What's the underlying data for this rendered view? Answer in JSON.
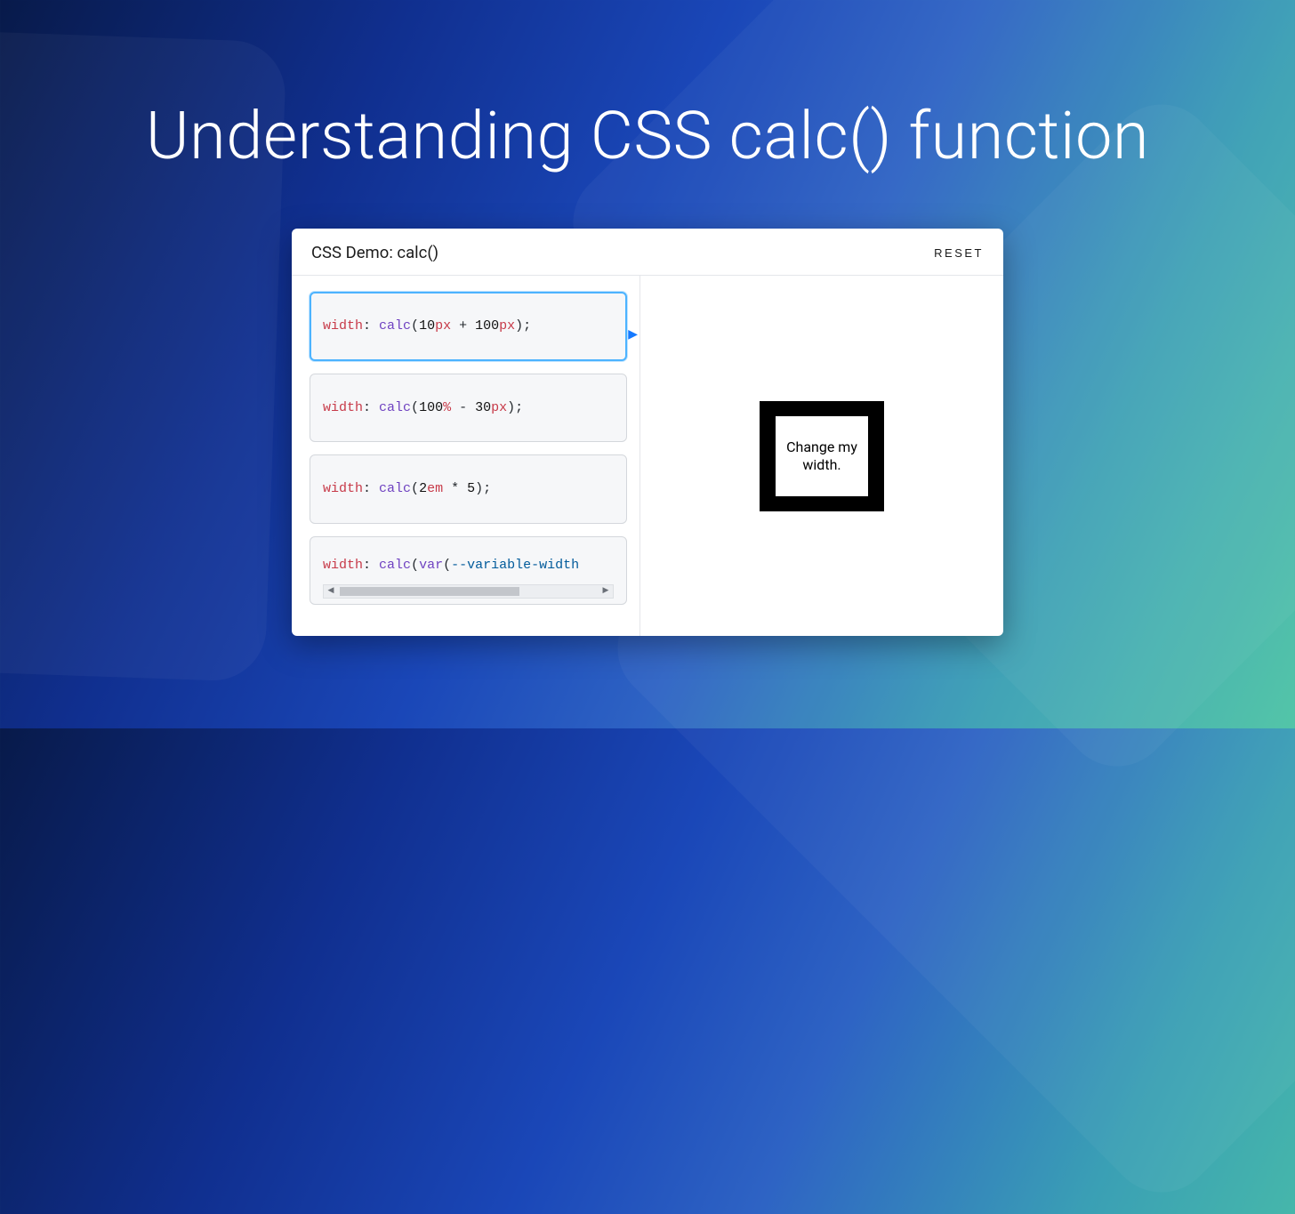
{
  "title": "Understanding CSS calc() function",
  "card": {
    "title": "CSS Demo: calc()",
    "reset_label": "RESET",
    "choices": {
      "c0": {
        "prop": "width",
        "func": "calc",
        "n1": "10",
        "u1": "px",
        "op": " + ",
        "n2": "100",
        "u2": "px",
        "tail": ");"
      },
      "c1": {
        "prop": "width",
        "func": "calc",
        "n1": "100",
        "u1": "%",
        "op": " - ",
        "n2": "30",
        "u2": "px",
        "tail": ");"
      },
      "c2": {
        "prop": "width",
        "func": "calc",
        "n1": "2",
        "u1": "em",
        "op": " * ",
        "n2": "5",
        "u2": "",
        "tail": ");"
      },
      "c3": {
        "prop": "width",
        "func": "calc",
        "varfn": "var",
        "varname": "--variable-width"
      }
    },
    "preview_text": "Change my width."
  }
}
